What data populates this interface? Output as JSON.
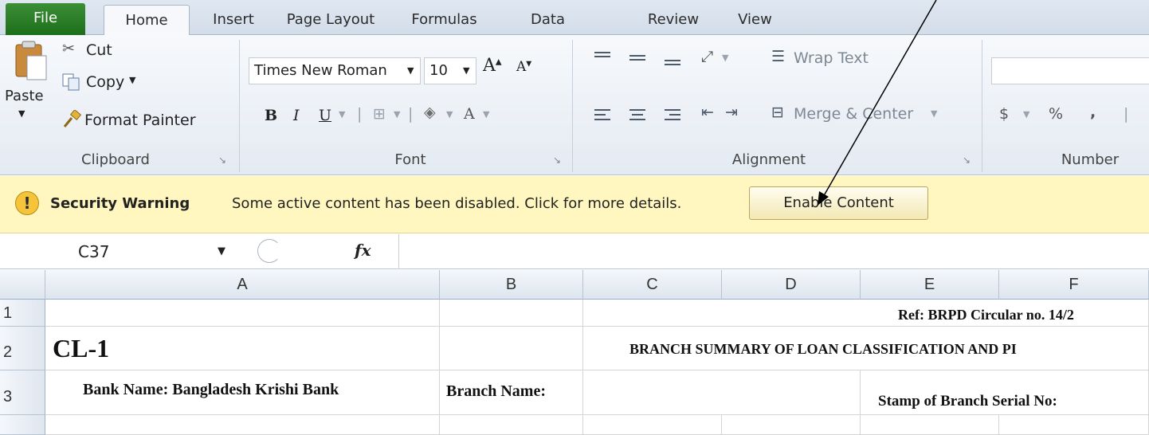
{
  "tabs": {
    "file": "File",
    "home": "Home",
    "insert": "Insert",
    "page_layout": "Page Layout",
    "formulas": "Formulas",
    "data": "Data",
    "review": "Review",
    "view": "View"
  },
  "ribbon": {
    "clipboard": {
      "paste": "Paste",
      "cut": "Cut",
      "copy": "Copy",
      "format_painter": "Format Painter",
      "label": "Clipboard"
    },
    "font": {
      "font_name": "Times New Roman",
      "font_size": "10",
      "bold": "B",
      "italic": "I",
      "underline": "U",
      "label": "Font"
    },
    "alignment": {
      "wrap_text": "Wrap Text",
      "merge_center": "Merge & Center",
      "label": "Alignment"
    },
    "number": {
      "currency": "$",
      "percent": "%",
      "comma": ",",
      "label": "Number"
    }
  },
  "security_bar": {
    "title": "Security Warning",
    "message": "Some active content has been disabled. Click for more details.",
    "button": "Enable Content"
  },
  "formula_bar": {
    "name_box": "C37",
    "fx": "fx",
    "content": ""
  },
  "grid": {
    "columns": [
      "A",
      "B",
      "C",
      "D",
      "E",
      "F"
    ],
    "rows": [
      "1",
      "2",
      "3"
    ],
    "cells": {
      "ref": "Ref: BRPD Circular no. 14/2",
      "title": "CL-1",
      "summary": "BRANCH SUMMARY OF LOAN  CLASSIFICATION AND PI",
      "bank_name": "Bank Name: Bangladesh Krishi Bank",
      "branch_name": "Branch Name:",
      "stamp": "Stamp of Branch Serial No:"
    }
  },
  "colors": {
    "file_tab": "#1d6e1a",
    "security_bar": "#fff7bf",
    "ribbon": "#e4eaf2"
  }
}
